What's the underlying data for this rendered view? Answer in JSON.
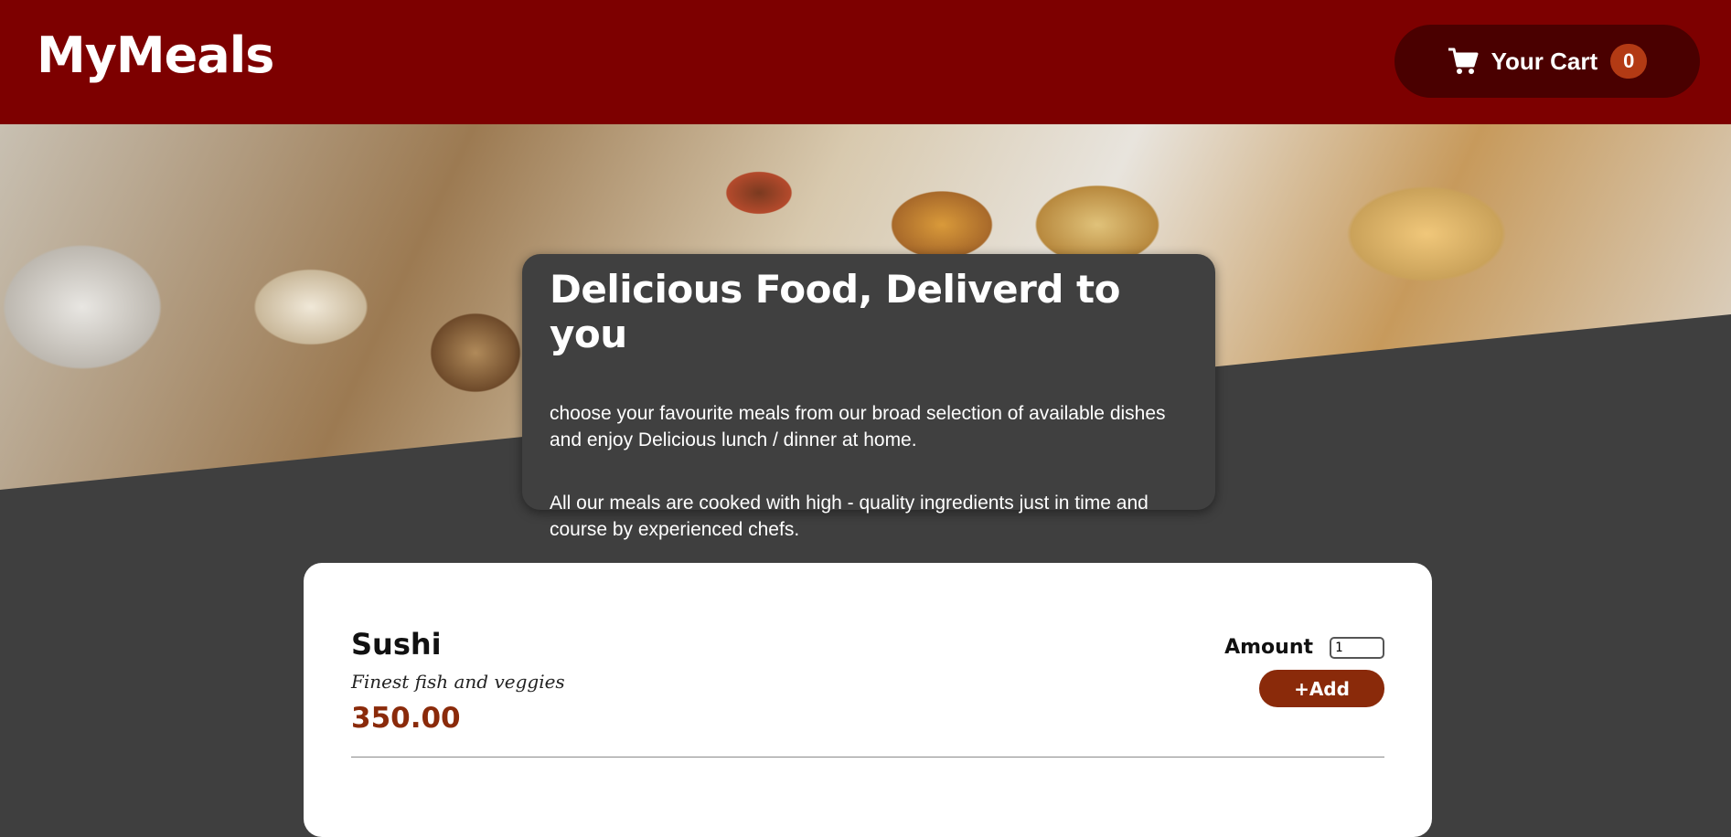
{
  "header": {
    "logo": "MyMeals",
    "cart_label": "Your Cart",
    "cart_count": "0",
    "cart_icon": "cart-icon"
  },
  "hero": {
    "title": "Delicious Food, Deliverd to you",
    "paragraph1": "choose your favourite meals from our broad selection of available dishes and enjoy Delicious lunch / dinner at home.",
    "paragraph2": "All our meals are cooked with high - quality ingredients just in time and course by experienced chefs."
  },
  "meals": [
    {
      "name": "Sushi",
      "description": "Finest fish and veggies",
      "price": "350.00",
      "amount_label": "Amount",
      "amount_value": "1",
      "add_label": "+Add"
    }
  ],
  "colors": {
    "header_bg": "#7d0000",
    "cart_bg": "#4a0000",
    "badge_bg": "#b33a14",
    "accent": "#8a2a0a",
    "page_bg": "#3f3f3f"
  }
}
